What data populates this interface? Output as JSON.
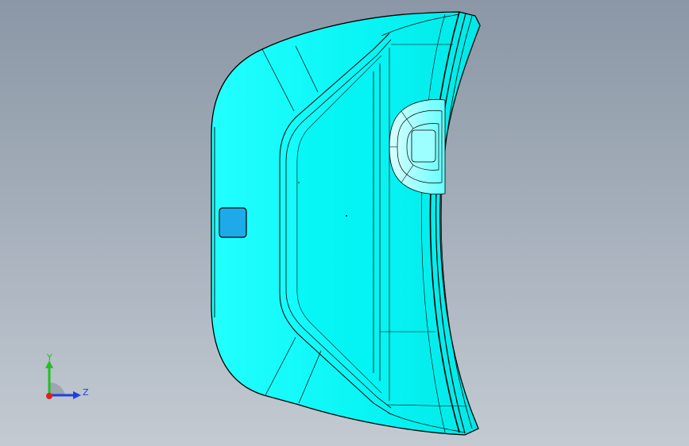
{
  "viewport": {
    "background_top": "#8b97a6",
    "background_bottom": "#c3cad2"
  },
  "model": {
    "part_color": "#00ffff",
    "edge_color": "#000000",
    "selected_face_color": "#1ea9e8"
  },
  "triad": {
    "y_label": "Y",
    "z_label": "Z",
    "y_color": "#1fc21f",
    "z_color": "#1f3fdf",
    "x_color": "#e01f1f"
  }
}
